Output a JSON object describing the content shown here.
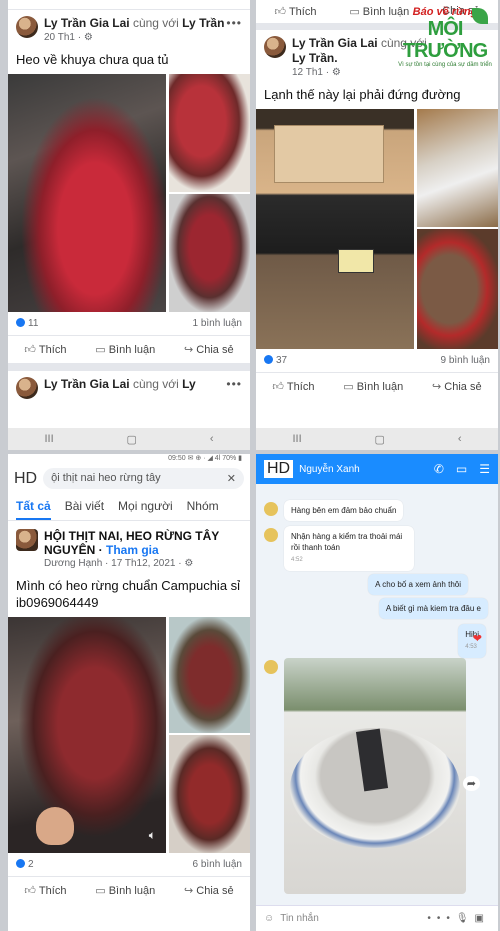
{
  "logo": {
    "line1": "Báo về rừng",
    "line2": "MÔI TRƯỜNG",
    "line3": "Vì sự tồn tại cùng của sự dầm triển"
  },
  "post1": {
    "author": "Ly Trần Gia Lai",
    "with_text": "cùng với",
    "with_name": "Ly Trần",
    "time": "20 Th1 · ⚙",
    "caption": "Heo về khuya chưa qua tủ",
    "likes": "11",
    "comments": "1 bình luận",
    "actions": [
      "Thích",
      "Bình luận",
      "Chia sẻ"
    ]
  },
  "post1b": {
    "author": "Ly Trần Gia Lai",
    "with_text": "cùng với",
    "with_name": "Ly"
  },
  "post2": {
    "top_actions": [
      "Thích",
      "Bình luận",
      "Chia sẻ"
    ],
    "author": "Ly Trần Gia Lai",
    "with_text": "cùng với",
    "with_name": "Ly Trần.",
    "time": "12 Th1 · ⚙",
    "caption": "Lạnh thế này lại phải đứng đường",
    "likes": "37",
    "comments": "9 bình luận",
    "actions": [
      "Thích",
      "Bình luận",
      "Chia sẻ"
    ]
  },
  "search": {
    "status": "09:50  ✉ ⊕ ·  ◢ 4l 70% ▮",
    "hd": "HD",
    "query": "ội thịt nai heo rừng tây",
    "tabs": [
      "Tất cả",
      "Bài viết",
      "Mọi người",
      "Nhóm"
    ],
    "group_name": "HỘI THỊT NAI, HEO RỪNG TÂY NGUYÊN",
    "join": "Tham gia",
    "poster": "Dương Hạnh · 17 Th12, 2021 · ⚙",
    "caption": "Mình có heo rừng chuẩn Campuchia sỉ ib0969064449",
    "likes": "2",
    "comments": "6 bình luận",
    "actions": [
      "Thích",
      "Bình luận",
      "Chia sẻ"
    ]
  },
  "chat": {
    "hd": "HD",
    "contact": "Nguyễn Xanh",
    "messages": [
      {
        "text": "Hàng bên em đảm bảo chuẩn",
        "time": ""
      },
      {
        "text": "Nhận hàng a kiểm tra thoải mái rồi thanh toán",
        "time": "4:52"
      },
      {
        "text": "A cho bố a xem ảnh thôi",
        "time": ""
      },
      {
        "text": "A biết gì mà kiem tra đâu e",
        "time": ""
      },
      {
        "text": "Hihi",
        "time": "4:53"
      }
    ],
    "composer_placeholder": "Tin nhắn"
  },
  "nav": [
    "III",
    "▢",
    "‹"
  ]
}
